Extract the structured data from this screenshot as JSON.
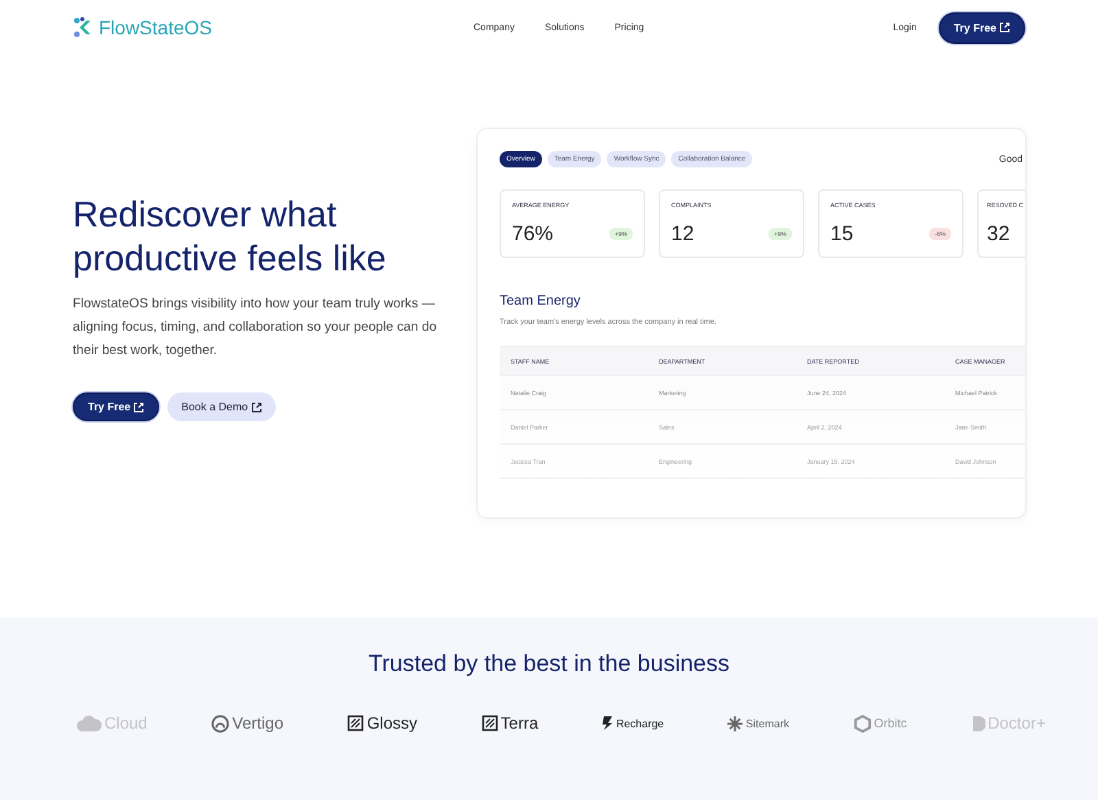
{
  "nav": {
    "brand": "FlowStateOS",
    "links": [
      "Company",
      "Solutions",
      "Pricing"
    ],
    "login": "Login",
    "cta": "Try Free"
  },
  "hero": {
    "title": "Rediscover what productive feels like",
    "text": "FlowstateOS brings visibility into how your team truly works — aligning focus, timing, and collaboration so your people can do their best work, together.",
    "buttons": [
      {
        "label": "Try Free",
        "kind": "primary"
      },
      {
        "label": "Book a Demo",
        "kind": "secondary"
      }
    ]
  },
  "dashboard": {
    "tabs": [
      {
        "label": "Overview",
        "selected": true
      },
      {
        "label": "Team Energy",
        "selected": false
      },
      {
        "label": "Workflow Sync",
        "selected": false
      },
      {
        "label": "Collaboration Balance",
        "selected": false
      }
    ],
    "greeting": "Good",
    "stats": [
      {
        "label": "AVERAGE ENERGY",
        "value": "76%",
        "change": "+9%",
        "color": "#dff5dc"
      },
      {
        "label": "COMPLAINTS",
        "value": "12",
        "change": "+9%",
        "color": "#dff5dc"
      },
      {
        "label": "ACTIVE CASES",
        "value": "15",
        "change": "-6%",
        "color": "#fbe0e0"
      },
      {
        "label": "RESOVED C",
        "value": "32"
      }
    ],
    "section_title": "Team Energy",
    "section_text": "Track your team's energy levels across the company in real time.",
    "table": {
      "columns": [
        "STAFF NAME",
        "DEAPARTMENT",
        "DATE REPORTED",
        "CASE MANAGER"
      ],
      "rows": [
        [
          "Natalie Craig",
          "Marketing",
          "June 24, 2024",
          "Michael Patrick"
        ],
        [
          "Daniel Parker",
          "Sales",
          "April 2, 2024",
          "Jane Smith"
        ],
        [
          "Jessica Tran",
          "Engineering",
          "January 15, 2024",
          "David Johnson"
        ]
      ]
    }
  },
  "trusted": {
    "title": "Trusted by the best in the business",
    "logos": [
      {
        "name": "Cloud",
        "kind": "cloud"
      },
      {
        "name": "Vertigo",
        "kind": "ring"
      },
      {
        "name": "Glossy",
        "kind": "square"
      },
      {
        "name": "Terra",
        "kind": "square"
      },
      {
        "name": "Recharge",
        "kind": "bolt"
      },
      {
        "name": "Sitemark",
        "kind": "star"
      },
      {
        "name": "Orbitc",
        "kind": "hex"
      },
      {
        "name": "Doctor+",
        "kind": "d"
      }
    ]
  }
}
